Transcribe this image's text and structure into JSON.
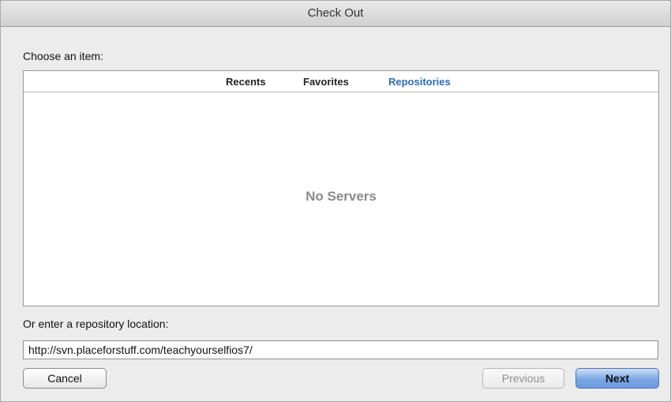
{
  "window": {
    "title": "Check Out"
  },
  "chooser": {
    "label": "Choose an item:",
    "tabs": [
      {
        "label": "Recents"
      },
      {
        "label": "Favorites"
      },
      {
        "label": "Repositories",
        "selected": true
      }
    ],
    "empty_message": "No Servers"
  },
  "location": {
    "label": "Or enter a repository location:",
    "value": "http://svn.placeforstuff.com/teachyourselfios7/"
  },
  "buttons": {
    "cancel": "Cancel",
    "previous": "Previous",
    "next": "Next"
  },
  "colors": {
    "selected_tab": "#2d6bbd",
    "default_button": "#7aa7e3"
  }
}
